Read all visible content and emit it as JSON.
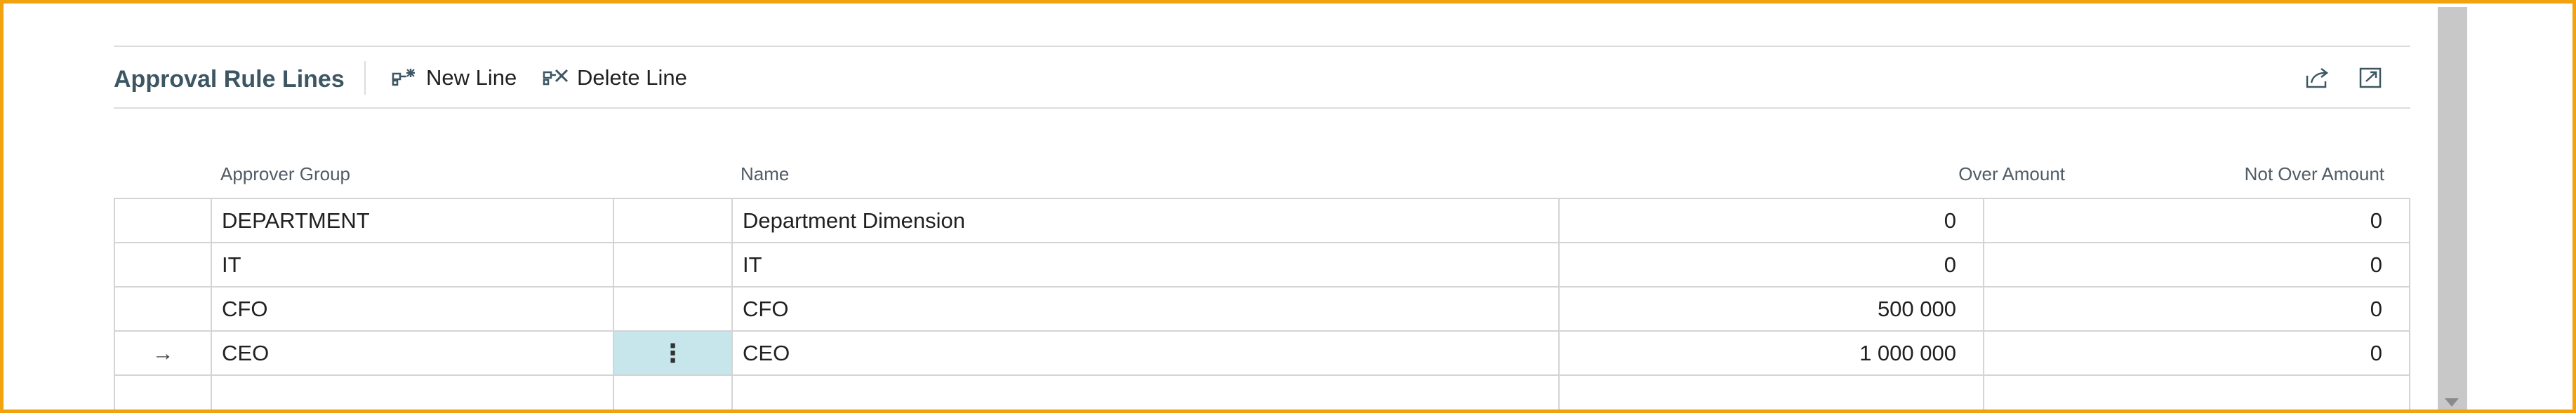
{
  "part": {
    "title": "Approval Rule Lines",
    "actions": [
      {
        "label": "New Line",
        "icon": "new-line-icon"
      },
      {
        "label": "Delete Line",
        "icon": "delete-line-icon"
      }
    ],
    "tools": [
      {
        "icon": "share-icon"
      },
      {
        "icon": "expand-icon"
      }
    ]
  },
  "columns": {
    "approver_group": "Approver Group",
    "name": "Name",
    "over_amount": "Over Amount",
    "not_over_amount": "Not Over Amount"
  },
  "rows": [
    {
      "indicator": "",
      "approver_group": "DEPARTMENT",
      "name": "Department Dimension",
      "over_amount": "0",
      "not_over_amount": "0",
      "selected": false
    },
    {
      "indicator": "",
      "approver_group": "IT",
      "name": "IT",
      "over_amount": "0",
      "not_over_amount": "0",
      "selected": false
    },
    {
      "indicator": "",
      "approver_group": "CFO",
      "name": "CFO",
      "over_amount": "500 000",
      "not_over_amount": "0",
      "selected": false
    },
    {
      "indicator": "→",
      "approver_group": "CEO",
      "name": "CEO",
      "over_amount": "1 000 000",
      "not_over_amount": "0",
      "selected": true,
      "row_menu": "⋮"
    },
    {
      "indicator": "",
      "approver_group": "",
      "name": "",
      "over_amount": "",
      "not_over_amount": "",
      "selected": false
    }
  ],
  "colors": {
    "frame": "#f2a20d",
    "title": "#3c5763",
    "selected_cell": "#c6e6ec",
    "scrollbar": "#c8c8c8"
  }
}
